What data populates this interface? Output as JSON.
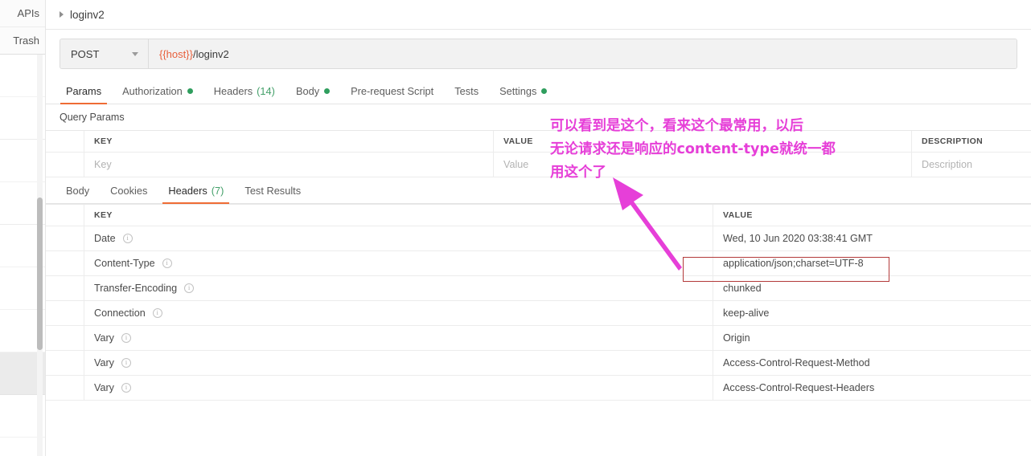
{
  "sidebar": {
    "tabs": [
      {
        "label": "APIs",
        "name": "sidebar-tab-apis"
      },
      {
        "label": "Trash",
        "name": "sidebar-tab-trash"
      }
    ]
  },
  "breadcrumb": {
    "caret_icon": "caret-right-icon",
    "label": "loginv2"
  },
  "request": {
    "method": "POST",
    "method_caret_icon": "chevron-down-icon",
    "url_variable": "{{host}}",
    "url_path": "/loginv2",
    "tabs": [
      {
        "label": "Params",
        "active": true,
        "dot": false,
        "count": ""
      },
      {
        "label": "Authorization",
        "active": false,
        "dot": true,
        "count": ""
      },
      {
        "label": "Headers",
        "active": false,
        "dot": false,
        "count": "(14)"
      },
      {
        "label": "Body",
        "active": false,
        "dot": true,
        "count": ""
      },
      {
        "label": "Pre-request Script",
        "active": false,
        "dot": false,
        "count": ""
      },
      {
        "label": "Tests",
        "active": false,
        "dot": false,
        "count": ""
      },
      {
        "label": "Settings",
        "active": false,
        "dot": true,
        "count": ""
      }
    ]
  },
  "query_params": {
    "title": "Query Params",
    "columns": [
      "KEY",
      "VALUE",
      "DESCRIPTION"
    ],
    "placeholder_row": {
      "key": "Key",
      "value": "Value",
      "description": "Description"
    }
  },
  "response": {
    "tabs": [
      {
        "label": "Body",
        "active": false,
        "count": ""
      },
      {
        "label": "Cookies",
        "active": false,
        "count": ""
      },
      {
        "label": "Headers",
        "active": true,
        "count": "(7)"
      },
      {
        "label": "Test Results",
        "active": false,
        "count": ""
      }
    ],
    "columns": [
      "KEY",
      "VALUE"
    ],
    "info_icon": "info-circle-icon",
    "rows": [
      {
        "key": "Date",
        "value": "Wed, 10 Jun 2020 03:38:41 GMT",
        "highlighted": false
      },
      {
        "key": "Content-Type",
        "value": "application/json;charset=UTF-8",
        "highlighted": true
      },
      {
        "key": "Transfer-Encoding",
        "value": "chunked",
        "highlighted": false
      },
      {
        "key": "Connection",
        "value": "keep-alive",
        "highlighted": false
      },
      {
        "key": "Vary",
        "value": "Origin",
        "highlighted": false
      },
      {
        "key": "Vary",
        "value": "Access-Control-Request-Method",
        "highlighted": false
      },
      {
        "key": "Vary",
        "value": "Access-Control-Request-Headers",
        "highlighted": false
      }
    ]
  },
  "annotation": {
    "text": "可以看到是这个，看来这个最常用，以后\n无论请求还是响应的content-type就统一都\n用这个了",
    "color": "#e63fd8",
    "arrow_icon": "arrow-up-left-icon",
    "highlight_color": "#b33a3a"
  }
}
